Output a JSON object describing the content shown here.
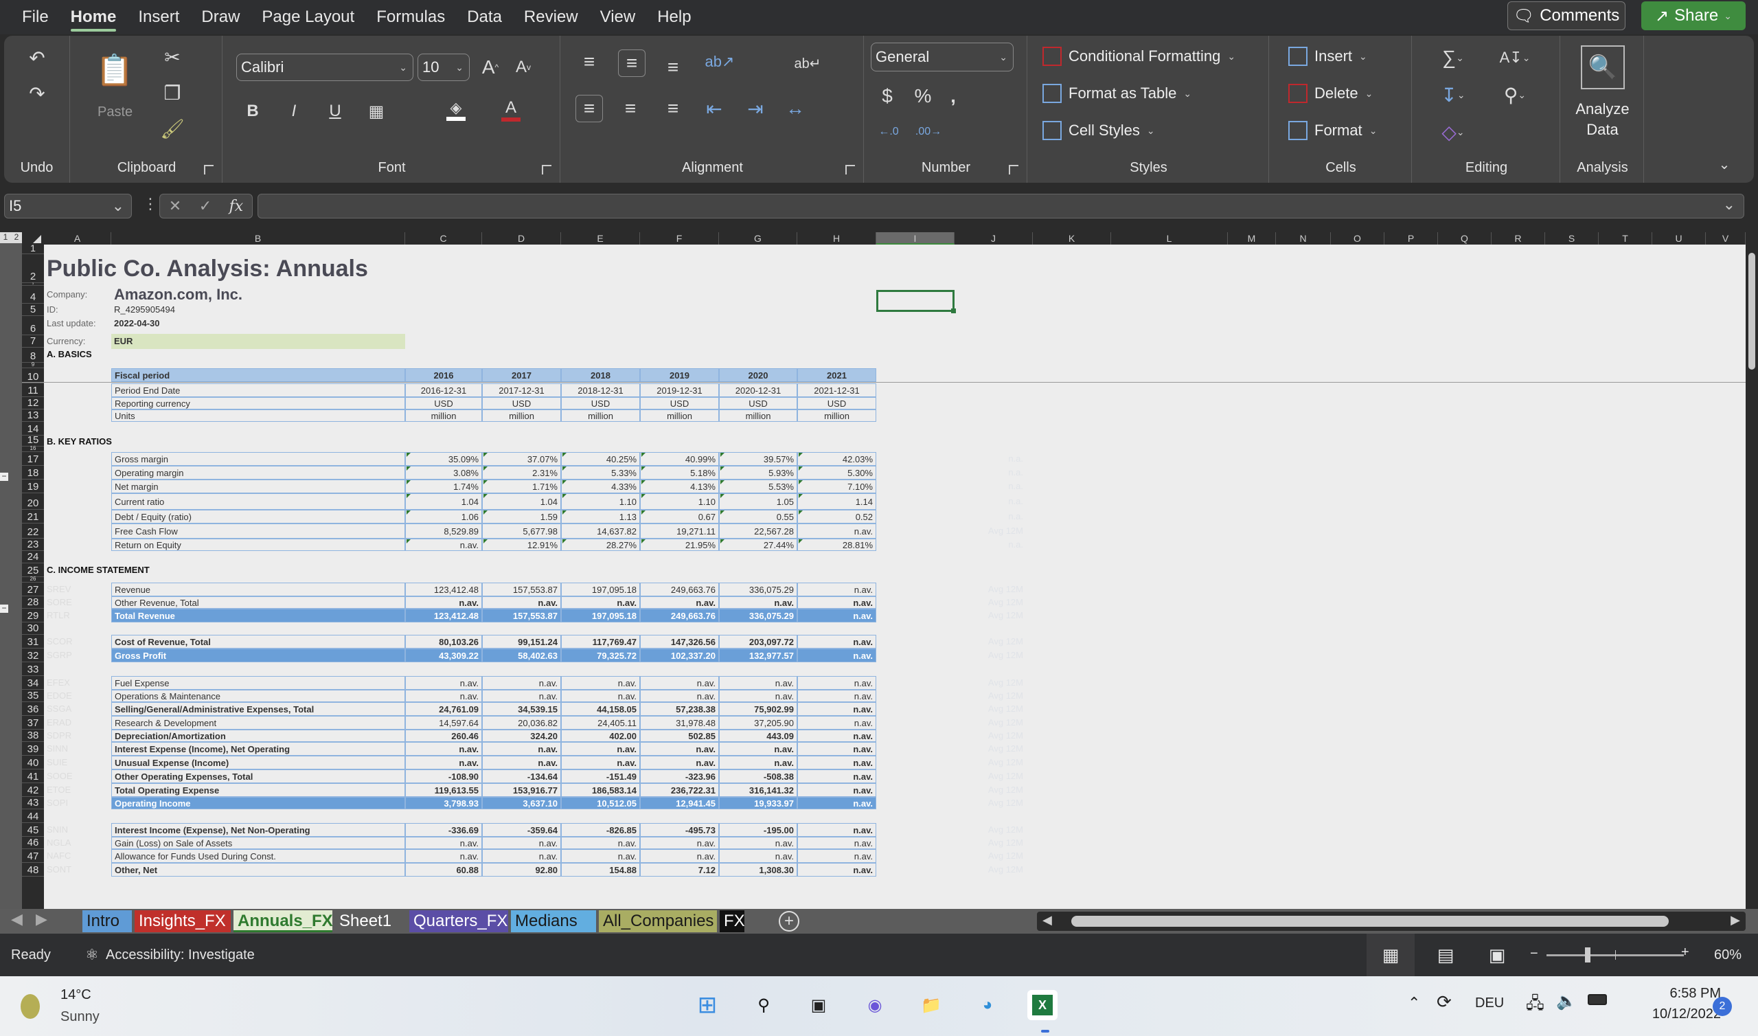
{
  "menu": {
    "items": [
      "File",
      "Home",
      "Insert",
      "Draw",
      "Page Layout",
      "Formulas",
      "Data",
      "Review",
      "View",
      "Help"
    ],
    "active": "Home",
    "comments_label": "Comments",
    "share_label": "Share"
  },
  "ribbon": {
    "groups": {
      "undo": "Undo",
      "clipboard": "Clipboard",
      "font": "Font",
      "alignment": "Alignment",
      "number": "Number",
      "styles": "Styles",
      "cells": "Cells",
      "editing": "Editing",
      "analysis": "Analysis"
    },
    "paste_label": "Paste",
    "font_name": "Calibri",
    "font_size": "10",
    "number_format": "General",
    "conditional_formatting": "Conditional Formatting",
    "format_as_table": "Format as Table",
    "cell_styles": "Cell Styles",
    "insert": "Insert",
    "delete": "Delete",
    "format": "Format",
    "analyze_data_1": "Analyze",
    "analyze_data_2": "Data",
    "font_color": "#c0282d",
    "fill_color": "#ffffff"
  },
  "formula_bar": {
    "name_box": "I5",
    "formula": ""
  },
  "columns": [
    "A",
    "B",
    "C",
    "D",
    "E",
    "F",
    "G",
    "H",
    "I",
    "J",
    "K",
    "L",
    "M",
    "N",
    "O",
    "P",
    "Q",
    "R",
    "S",
    "T",
    "U",
    "V"
  ],
  "selected_column": "I",
  "selected_cell": "I5",
  "sheet": {
    "title": "Public Co. Analysis: Annuals",
    "company_label": "Company:",
    "company": "Amazon.com, Inc.",
    "id_label": "ID:",
    "id": "R_4295905494",
    "last_update_label": "Last update:",
    "last_update": "2022-04-30",
    "currency_label": "Currency:",
    "currency": "EUR",
    "section_a": "A. BASICS",
    "section_b": "B. KEY RATIOS",
    "section_c": "C. INCOME STATEMENT",
    "basics": {
      "header_label": "Fiscal period",
      "years": [
        "2016",
        "2017",
        "2018",
        "2019",
        "2020",
        "2021"
      ],
      "rows": [
        {
          "row": "11",
          "label": "Period End Date",
          "values": [
            "2016-12-31",
            "2017-12-31",
            "2018-12-31",
            "2019-12-31",
            "2020-12-31",
            "2021-12-31"
          ]
        },
        {
          "row": "12",
          "label": "Reporting currency",
          "values": [
            "USD",
            "USD",
            "USD",
            "USD",
            "USD",
            "USD"
          ]
        },
        {
          "row": "13",
          "label": "Units",
          "values": [
            "million",
            "million",
            "million",
            "million",
            "million",
            "million"
          ]
        }
      ]
    },
    "ratios": [
      {
        "row": "17",
        "label": "Gross margin",
        "values": [
          "35.09%",
          "37.07%",
          "40.25%",
          "40.99%",
          "39.57%",
          "42.03%"
        ],
        "note": "n.a."
      },
      {
        "row": "18",
        "label": "Operating margin",
        "values": [
          "3.08%",
          "2.31%",
          "5.33%",
          "5.18%",
          "5.93%",
          "5.30%"
        ],
        "note": "n.a."
      },
      {
        "row": "19",
        "label": "Net margin",
        "values": [
          "1.74%",
          "1.71%",
          "4.33%",
          "4.13%",
          "5.53%",
          "7.10%"
        ],
        "note": "n.a."
      },
      {
        "row": "20",
        "label": "Current ratio",
        "values": [
          "1.04",
          "1.04",
          "1.10",
          "1.10",
          "1.05",
          "1.14"
        ],
        "note": "n.a."
      },
      {
        "row": "21",
        "label": "Debt / Equity (ratio)",
        "values": [
          "1.06",
          "1.59",
          "1.13",
          "0.67",
          "0.55",
          "0.52"
        ],
        "note": "n.a."
      },
      {
        "row": "22",
        "label": "Free Cash Flow",
        "values": [
          "8,529.89",
          "5,677.98",
          "14,637.82",
          "19,271.11",
          "22,567.28",
          "n.av."
        ],
        "note": "Avg 12M"
      },
      {
        "row": "23",
        "label": "Return on Equity",
        "values": [
          "n.av.",
          "12.91%",
          "28.27%",
          "21.95%",
          "27.44%",
          "28.81%"
        ],
        "note": "n.a."
      }
    ],
    "income": [
      {
        "row": "27",
        "code": "SREV",
        "label": "Revenue",
        "bold": false,
        "total": false,
        "values": [
          "123,412.48",
          "157,553.87",
          "197,095.18",
          "249,663.76",
          "336,075.29",
          "n.av."
        ],
        "note": "Avg 12M"
      },
      {
        "row": "28",
        "code": "SORE",
        "label": "Other Revenue, Total",
        "bold": false,
        "total": false,
        "boldvals": true,
        "values": [
          "n.av.",
          "n.av.",
          "n.av.",
          "n.av.",
          "n.av.",
          "n.av."
        ],
        "note": "Avg 12M"
      },
      {
        "row": "29",
        "code": "RTLR",
        "label": "Total Revenue",
        "bold": true,
        "total": true,
        "values": [
          "123,412.48",
          "157,553.87",
          "197,095.18",
          "249,663.76",
          "336,075.29",
          "n.av."
        ],
        "note": "Avg 12M"
      },
      {
        "row": "31",
        "code": "SCOR",
        "label": "Cost of Revenue, Total",
        "bold": true,
        "total": false,
        "values": [
          "80,103.26",
          "99,151.24",
          "117,769.47",
          "147,326.56",
          "203,097.72",
          "n.av."
        ],
        "note": "Avg 12M"
      },
      {
        "row": "32",
        "code": "SGRP",
        "label": "Gross Profit",
        "bold": true,
        "total": true,
        "values": [
          "43,309.22",
          "58,402.63",
          "79,325.72",
          "102,337.20",
          "132,977.57",
          "n.av."
        ],
        "note": "Avg 12M"
      },
      {
        "row": "34",
        "code": "EFEX",
        "label": "Fuel Expense",
        "bold": false,
        "total": false,
        "values": [
          "n.av.",
          "n.av.",
          "n.av.",
          "n.av.",
          "n.av.",
          "n.av."
        ],
        "note": "Avg 12M"
      },
      {
        "row": "35",
        "code": "EDOE",
        "label": "Operations & Maintenance",
        "bold": false,
        "total": false,
        "values": [
          "n.av.",
          "n.av.",
          "n.av.",
          "n.av.",
          "n.av.",
          "n.av."
        ],
        "note": "Avg 12M"
      },
      {
        "row": "36",
        "code": "SSGA",
        "label": "Selling/General/Administrative Expenses, Total",
        "bold": true,
        "total": false,
        "values": [
          "24,761.09",
          "34,539.15",
          "44,158.05",
          "57,238.38",
          "75,902.99",
          "n.av."
        ],
        "note": "Avg 12M"
      },
      {
        "row": "37",
        "code": "ERAD",
        "label": "Research & Development",
        "bold": false,
        "total": false,
        "values": [
          "14,597.64",
          "20,036.82",
          "24,405.11",
          "31,978.48",
          "37,205.90",
          "n.av."
        ],
        "note": "Avg 12M"
      },
      {
        "row": "38",
        "code": "SDPR",
        "label": "Depreciation/Amortization",
        "bold": true,
        "total": false,
        "values": [
          "260.46",
          "324.20",
          "402.00",
          "502.85",
          "443.09",
          "n.av."
        ],
        "note": "Avg 12M"
      },
      {
        "row": "39",
        "code": "SINN",
        "label": "Interest Expense (Income), Net Operating",
        "bold": true,
        "total": false,
        "values": [
          "n.av.",
          "n.av.",
          "n.av.",
          "n.av.",
          "n.av.",
          "n.av."
        ],
        "note": "Avg 12M"
      },
      {
        "row": "40",
        "code": "SUIE",
        "label": "Unusual Expense (Income)",
        "bold": true,
        "total": false,
        "values": [
          "n.av.",
          "n.av.",
          "n.av.",
          "n.av.",
          "n.av.",
          "n.av."
        ],
        "note": "Avg 12M"
      },
      {
        "row": "41",
        "code": "SOOE",
        "label": "Other Operating Expenses, Total",
        "bold": true,
        "total": false,
        "values": [
          "-108.90",
          "-134.64",
          "-151.49",
          "-323.96",
          "-508.38",
          "n.av."
        ],
        "note": "Avg 12M"
      },
      {
        "row": "42",
        "code": "ETOE",
        "label": "Total Operating Expense",
        "bold": true,
        "total": false,
        "values": [
          "119,613.55",
          "153,916.77",
          "186,583.14",
          "236,722.31",
          "316,141.32",
          "n.av."
        ],
        "note": "Avg 12M"
      },
      {
        "row": "43",
        "code": "SOPI",
        "label": "Operating Income",
        "bold": true,
        "total": true,
        "values": [
          "3,798.93",
          "3,637.10",
          "10,512.05",
          "12,941.45",
          "19,933.97",
          "n.av."
        ],
        "note": "Avg 12M"
      },
      {
        "row": "45",
        "code": "SNIN",
        "label": "Interest Income (Expense), Net Non-Operating",
        "bold": true,
        "total": false,
        "values": [
          "-336.69",
          "-359.64",
          "-826.85",
          "-495.73",
          "-195.00",
          "n.av."
        ],
        "note": "Avg 12M"
      },
      {
        "row": "46",
        "code": "NGLA",
        "label": "Gain (Loss) on Sale of Assets",
        "bold": false,
        "total": false,
        "values": [
          "n.av.",
          "n.av.",
          "n.av.",
          "n.av.",
          "n.av.",
          "n.av."
        ],
        "note": "Avg 12M"
      },
      {
        "row": "47",
        "code": "NAFC",
        "label": "Allowance for Funds Used During Const.",
        "bold": false,
        "total": false,
        "values": [
          "n.av.",
          "n.av.",
          "n.av.",
          "n.av.",
          "n.av.",
          "n.av."
        ],
        "note": "Avg 12M"
      },
      {
        "row": "48",
        "code": "SONT",
        "label": "Other, Net",
        "bold": true,
        "total": false,
        "values": [
          "60.88",
          "92.80",
          "154.88",
          "7.12",
          "1,308.30",
          "n.av."
        ],
        "note": "Avg 12M"
      }
    ]
  },
  "tabs": [
    {
      "label": "Intro",
      "color": "#5f9bd6",
      "text": "#1a1a1a"
    },
    {
      "label": "Insights_FX",
      "color": "#c0302b",
      "text": "#ffffff"
    },
    {
      "label": "Annuals_FX",
      "color": "#e2ecd2",
      "text": "#2f7a2f",
      "active": true
    },
    {
      "label": "Sheet1",
      "color": "#5c5c5c",
      "text": "#ffffff"
    },
    {
      "label": "Quarters_FX",
      "color": "#5b4ea6",
      "text": "#ffffff"
    },
    {
      "label": "Medians",
      "color": "#62aee0",
      "text": "#1a1a1a"
    },
    {
      "label": "All_Companies",
      "color": "#a9ad63",
      "text": "#1a1a1a"
    },
    {
      "label": "FX",
      "color": "#111111",
      "text": "#ffffff"
    }
  ],
  "status": {
    "ready": "Ready",
    "accessibility": "Accessibility: Investigate",
    "zoom": "60%",
    "zoom_fraction": 0.3
  },
  "taskbar": {
    "temperature": "14°C",
    "weather": "Sunny",
    "language": "DEU",
    "time": "6:58 PM",
    "date": "10/12/2022",
    "notifications": "2"
  }
}
